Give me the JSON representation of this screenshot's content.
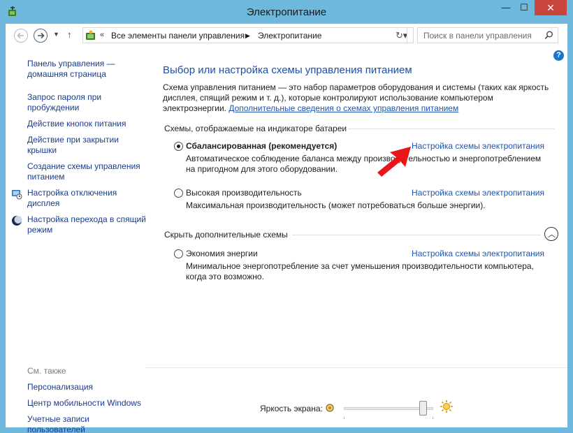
{
  "window": {
    "title": "Электропитание",
    "minimize": "—",
    "maximize": "☐",
    "close": "✕"
  },
  "address": {
    "chevrons": "«",
    "crumbs": [
      "Все элементы панели управления",
      "Электропитание"
    ],
    "search_placeholder": "Поиск в панели управления"
  },
  "sidebar": {
    "items": [
      {
        "label": "Панель управления — домашняя страница"
      },
      {
        "label": "Запрос пароля при пробуждении"
      },
      {
        "label": "Действие кнопок питания"
      },
      {
        "label": "Действие при закрытии крышки"
      },
      {
        "label": "Создание схемы управления питанием"
      },
      {
        "label": "Настройка отключения дисплея",
        "icon": "display-icon"
      },
      {
        "label": "Настройка перехода в спящий режим",
        "icon": "moon-icon"
      }
    ],
    "see_also": "См. также",
    "see_also_items": [
      "Персонализация",
      "Центр мобильности Windows",
      "Учетные записи пользователей"
    ]
  },
  "main": {
    "title": "Выбор или настройка схемы управления питанием",
    "description": "Схема управления питанием — это набор параметров оборудования и системы (таких как яркость дисплея, спящий режим и т. д.), которые контролируют использование компьютером электроэнергии.",
    "description_link": "Дополнительные сведения о схемах управления питанием",
    "group_battery": "Схемы, отображаемые на индикаторе батареи",
    "group_hidden": "Скрыть дополнительные схемы",
    "plans": [
      {
        "name": "Сбалансированная (рекомендуется)",
        "selected": true,
        "link": "Настройка схемы электропитания",
        "description": "Автоматическое соблюдение баланса между производительностью и энергопотреблением на пригодном для этого оборудовании."
      },
      {
        "name": "Высокая производительность",
        "selected": false,
        "link": "Настройка схемы электропитания",
        "description": "Максимальная производительность (может потребоваться больше энергии)."
      },
      {
        "name": "Экономия энергии",
        "selected": false,
        "link": "Настройка схемы электропитания",
        "description": "Минимальное энергопотребление за счет уменьшения производительности компьютера, когда это возможно."
      }
    ]
  },
  "brightness": {
    "label": "Яркость экрана:",
    "level_fraction": 0.92
  },
  "colors": {
    "frame": "#6fb8dd",
    "link": "#1c55b5",
    "title": "#1c4fa5",
    "close": "#c7453a",
    "annotation_arrow": "#e8161b"
  }
}
